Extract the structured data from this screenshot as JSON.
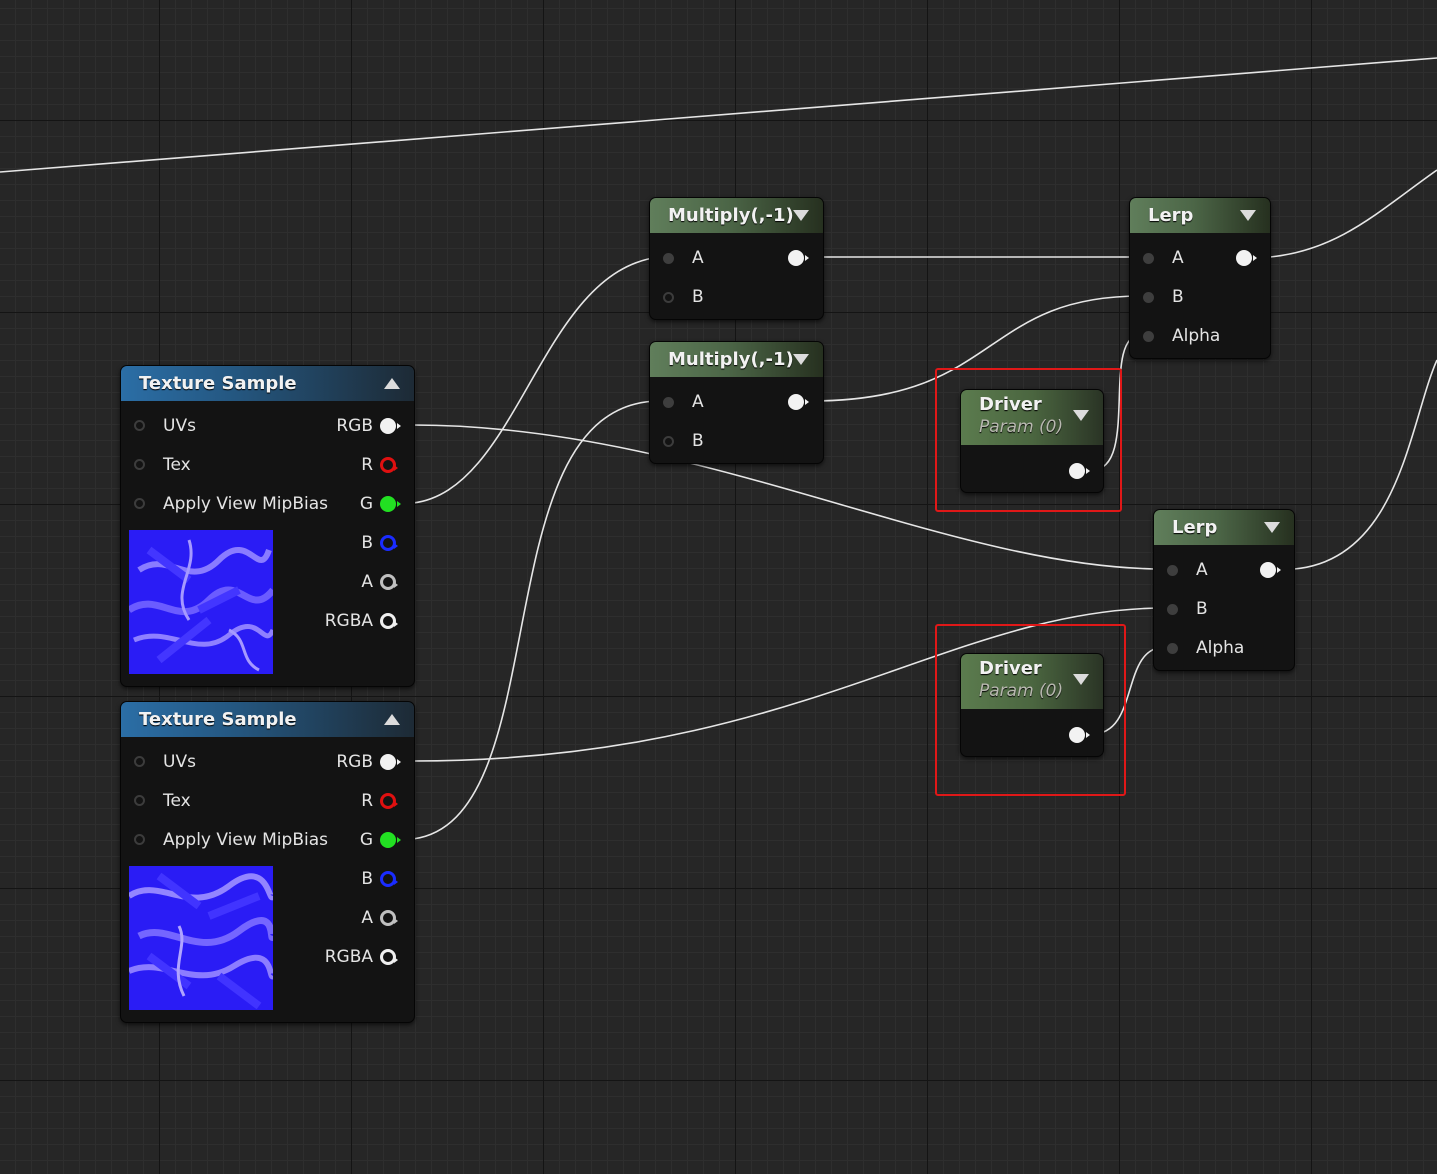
{
  "colors": {
    "texture_header": "#2b6ea6",
    "math_header": "#607e5b",
    "param_header": "#5b7b4e",
    "wire": "#e6e6e6",
    "pin_r": "#e01010",
    "pin_g": "#22e022",
    "pin_b": "#1a2cff",
    "highlight": "#e01818"
  },
  "texture_samples": [
    {
      "title": "Texture Sample",
      "inputs": [
        "UVs",
        "Tex",
        "Apply View MipBias"
      ],
      "outputs": [
        "RGB",
        "R",
        "G",
        "B",
        "A",
        "RGBA"
      ]
    },
    {
      "title": "Texture Sample",
      "inputs": [
        "UVs",
        "Tex",
        "Apply View MipBias"
      ],
      "outputs": [
        "RGB",
        "R",
        "G",
        "B",
        "A",
        "RGBA"
      ]
    }
  ],
  "multiply_nodes": [
    {
      "title": "Multiply(,-1)",
      "inputs": [
        "A",
        "B"
      ]
    },
    {
      "title": "Multiply(,-1)",
      "inputs": [
        "A",
        "B"
      ]
    }
  ],
  "lerp_nodes": [
    {
      "title": "Lerp",
      "inputs": [
        "A",
        "B",
        "Alpha"
      ]
    },
    {
      "title": "Lerp",
      "inputs": [
        "A",
        "B",
        "Alpha"
      ]
    }
  ],
  "driver_nodes": [
    {
      "title": "Driver",
      "subtitle": "Param (0)"
    },
    {
      "title": "Driver",
      "subtitle": "Param (0)"
    }
  ]
}
